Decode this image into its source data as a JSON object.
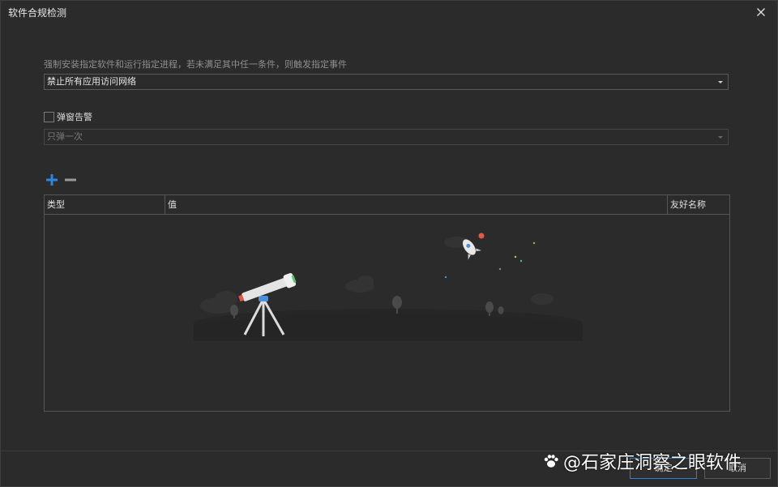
{
  "window": {
    "title": "软件合规检测",
    "close_icon": "close-icon"
  },
  "form": {
    "description": "强制安装指定软件和运行指定进程，若未满足其中任一条件，则触发指定事件",
    "event_select": {
      "value": "禁止所有应用访问网络"
    },
    "popup_alert": {
      "label": "弹窗告警",
      "checked": false
    },
    "popup_freq_select": {
      "value": "只弹一次",
      "disabled": true
    }
  },
  "toolbar": {
    "add_icon": "plus-icon",
    "remove_icon": "minus-icon",
    "add_color": "#2f86e0",
    "remove_color": "#9a9a9a"
  },
  "table": {
    "columns": [
      "类型",
      "值",
      "友好名称"
    ],
    "rows": []
  },
  "footer": {
    "ok_label": "确定",
    "cancel_label": "取消",
    "accent_color": "#2b7fd6"
  },
  "watermark": {
    "text": "@石家庄洞察之眼软件"
  }
}
